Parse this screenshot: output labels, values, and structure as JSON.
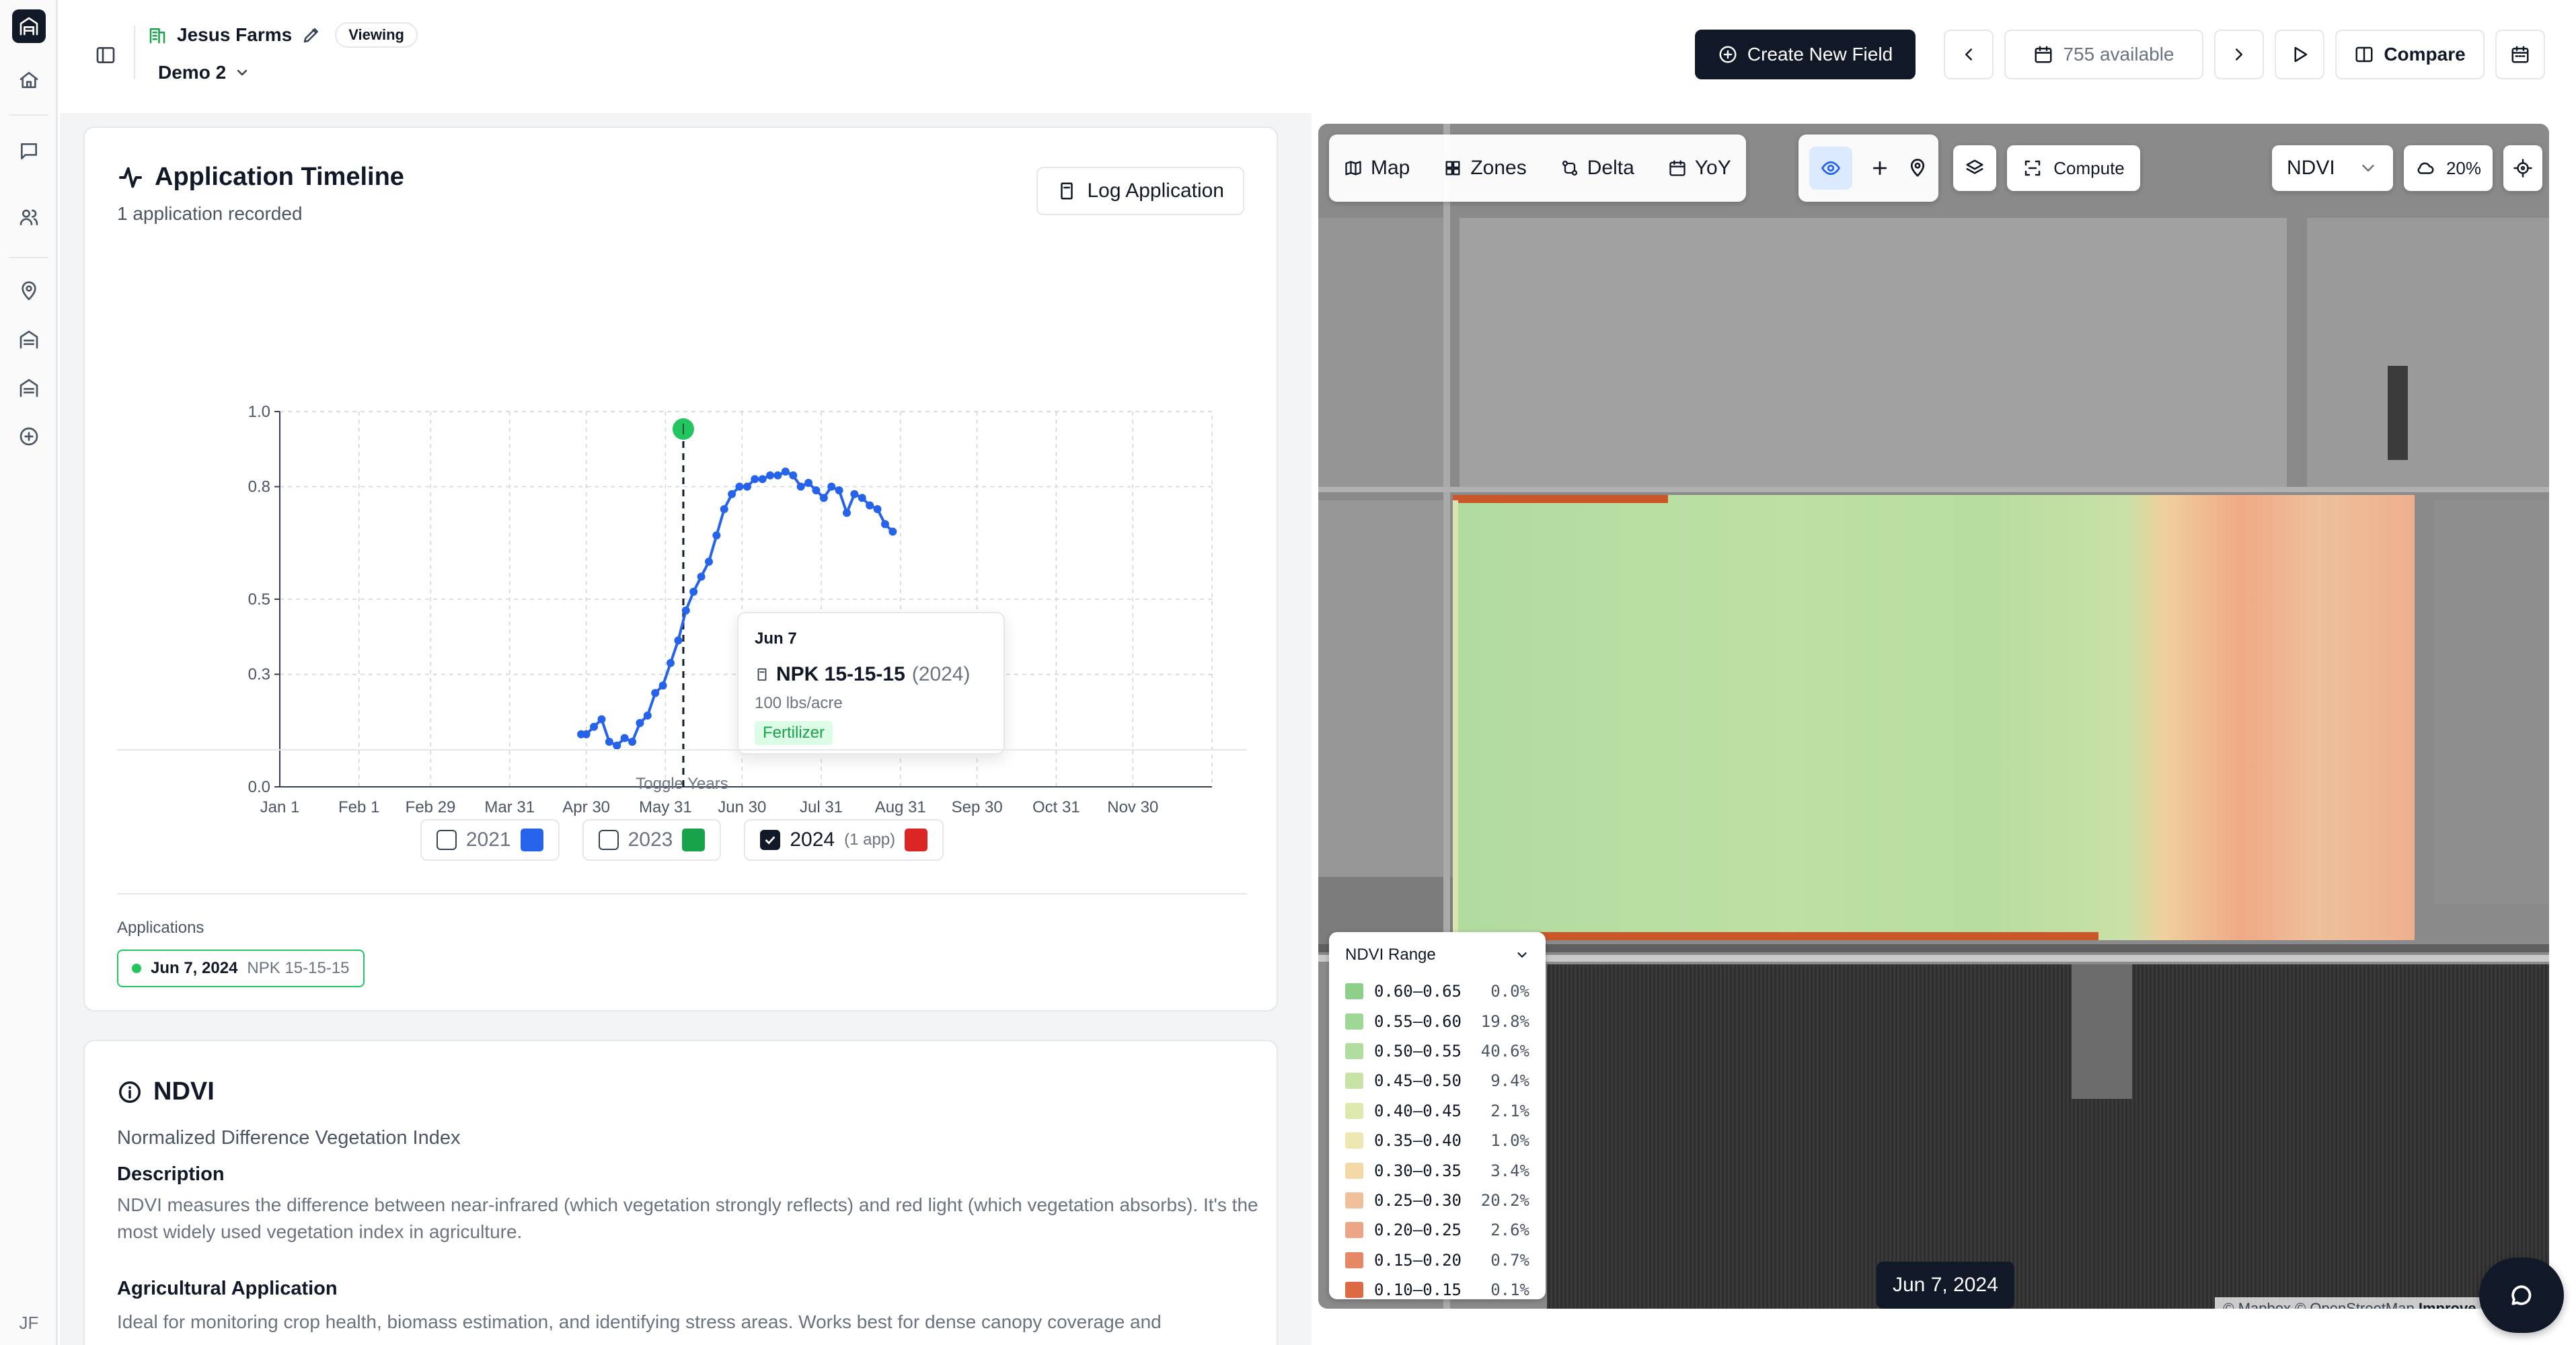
{
  "rail": {
    "items": [
      "home-icon",
      "message-icon",
      "users-icon",
      "map-pin-icon",
      "database-icon",
      "layers-icon",
      "plus-circle-icon"
    ],
    "user_initials": "JF"
  },
  "header": {
    "farm_name": "Jesus Farms",
    "mode_badge": "Viewing",
    "field_name": "Demo 2",
    "create_button": "Create New Field",
    "available_label": "755 available",
    "compare_label": "Compare"
  },
  "timeline": {
    "title": "Application Timeline",
    "subtitle": "1 application recorded",
    "log_button": "Log Application",
    "tooltip": {
      "date": "Jun 7",
      "product": "NPK 15-15-15",
      "year": "(2024)",
      "rate": "100 lbs/acre",
      "category": "Fertilizer"
    },
    "toggle_title": "Toggle Years",
    "years": [
      {
        "label": "2021",
        "checked": false,
        "color": "#2563eb",
        "apps": ""
      },
      {
        "label": "2023",
        "checked": false,
        "color": "#16a34a",
        "apps": ""
      },
      {
        "label": "2024",
        "checked": true,
        "color": "#dc2626",
        "apps": "(1 app)"
      }
    ],
    "applications_title": "Applications",
    "application_chip": {
      "date": "Jun 7, 2024",
      "product": "NPK 15-15-15"
    }
  },
  "chart_data": {
    "type": "line",
    "title": "",
    "xlabel": "",
    "ylabel": "",
    "x_ticks": [
      "Jan 1",
      "Feb 1",
      "Feb 29",
      "Mar 31",
      "Apr 30",
      "May 31",
      "Jun 30",
      "Jul 31",
      "Aug 31",
      "Sep 30",
      "Oct 31",
      "Nov 30"
    ],
    "y_ticks": [
      "0.0",
      "0.3",
      "0.5",
      "0.8",
      "1.0"
    ],
    "ylim": [
      0,
      1
    ],
    "grid": true,
    "series": [
      {
        "color": "#2563eb",
        "points": [
          [
            "Apr 28",
            0.14
          ],
          [
            "Apr 30",
            0.14
          ],
          [
            "May 3",
            0.16
          ],
          [
            "May 6",
            0.18
          ],
          [
            "May 9",
            0.12
          ],
          [
            "May 12",
            0.11
          ],
          [
            "May 15",
            0.13
          ],
          [
            "May 18",
            0.12
          ],
          [
            "May 21",
            0.17
          ],
          [
            "May 24",
            0.19
          ],
          [
            "May 27",
            0.25
          ],
          [
            "May 30",
            0.27
          ],
          [
            "Jun 2",
            0.33
          ],
          [
            "Jun 5",
            0.39
          ],
          [
            "Jun 8",
            0.47
          ],
          [
            "Jun 11",
            0.52
          ],
          [
            "Jun 14",
            0.56
          ],
          [
            "Jun 17",
            0.6
          ],
          [
            "Jun 20",
            0.67
          ],
          [
            "Jun 23",
            0.74
          ],
          [
            "Jun 26",
            0.78
          ],
          [
            "Jun 29",
            0.8
          ],
          [
            "Jul 2",
            0.8
          ],
          [
            "Jul 5",
            0.82
          ],
          [
            "Jul 8",
            0.82
          ],
          [
            "Jul 11",
            0.83
          ],
          [
            "Jul 14",
            0.83
          ],
          [
            "Jul 17",
            0.84
          ],
          [
            "Jul 20",
            0.83
          ],
          [
            "Jul 23",
            0.8
          ],
          [
            "Jul 26",
            0.81
          ],
          [
            "Jul 29",
            0.79
          ],
          [
            "Aug 1",
            0.77
          ],
          [
            "Aug 4",
            0.8
          ],
          [
            "Aug 7",
            0.79
          ],
          [
            "Aug 10",
            0.73
          ],
          [
            "Aug 13",
            0.78
          ],
          [
            "Aug 16",
            0.77
          ],
          [
            "Aug 19",
            0.75
          ],
          [
            "Aug 22",
            0.74
          ],
          [
            "Aug 25",
            0.7
          ],
          [
            "Aug 28",
            0.68
          ]
        ]
      }
    ],
    "annotation": {
      "date": "Jun 7",
      "marker_color": "#22c55e"
    }
  },
  "ndvi_info": {
    "title": "NDVI",
    "subtitle": "Normalized Difference Vegetation Index",
    "description_heading": "Description",
    "description": "NDVI measures the difference between near-infrared (which vegetation strongly reflects) and red light (which vegetation absorbs). It's the most widely used vegetation index in agriculture.",
    "application_heading": "Agricultural Application",
    "application_text": "Ideal for monitoring crop health, biomass estimation, and identifying stress areas. Works best for dense canopy coverage and"
  },
  "map": {
    "tabs": [
      {
        "label": "Map",
        "icon": "map-icon"
      },
      {
        "label": "Zones",
        "icon": "grid-icon"
      },
      {
        "label": "Delta",
        "icon": "git-compare-icon"
      },
      {
        "label": "YoY",
        "icon": "calendar-icon"
      }
    ],
    "compute_label": "Compute",
    "index_select": "NDVI",
    "cloud_label": "20%",
    "legend_title": "NDVI Range",
    "legend": [
      {
        "range": "0.60–0.65",
        "pct": "0.0%",
        "color": "#8cd08a"
      },
      {
        "range": "0.55–0.60",
        "pct": "19.8%",
        "color": "#9fd796"
      },
      {
        "range": "0.50–0.55",
        "pct": "40.6%",
        "color": "#b3dd9e"
      },
      {
        "range": "0.45–0.50",
        "pct": "9.4%",
        "color": "#c7e3a5"
      },
      {
        "range": "0.40–0.45",
        "pct": "2.1%",
        "color": "#dde8ad"
      },
      {
        "range": "0.35–0.40",
        "pct": "1.0%",
        "color": "#efe7b2"
      },
      {
        "range": "0.30–0.35",
        "pct": "3.4%",
        "color": "#f3d9a7"
      },
      {
        "range": "0.25–0.30",
        "pct": "20.2%",
        "color": "#f0c09a"
      },
      {
        "range": "0.20–0.25",
        "pct": "2.6%",
        "color": "#eca585"
      },
      {
        "range": "0.15–0.20",
        "pct": "0.7%",
        "color": "#e68765"
      },
      {
        "range": "0.10–0.15",
        "pct": "0.1%",
        "color": "#dc6a42"
      }
    ],
    "date_label": "Jun 7, 2024",
    "attribution": "© Mapbox © OpenStreetMap",
    "attribution_link": "Improve this map"
  }
}
